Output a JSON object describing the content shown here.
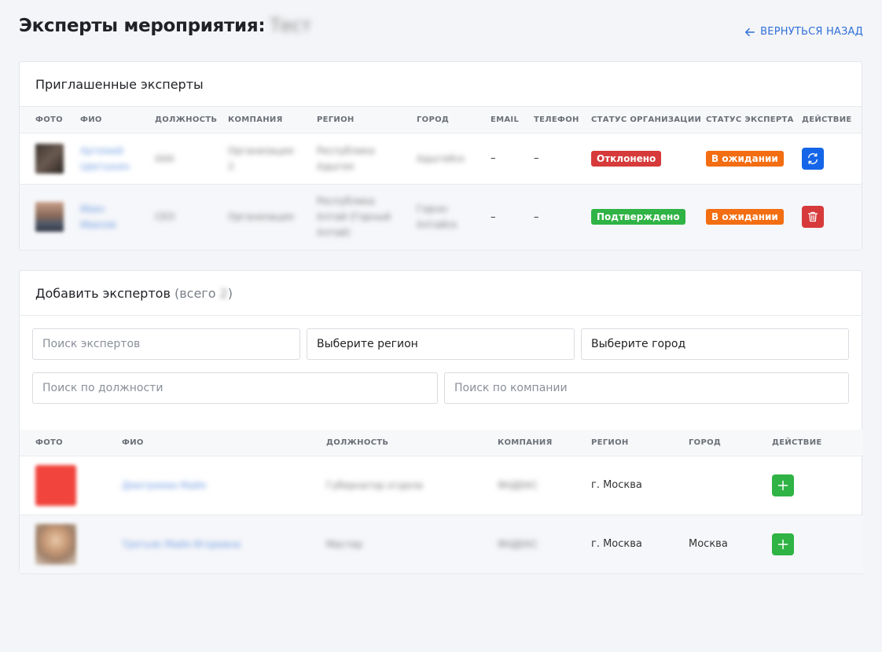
{
  "header": {
    "title": "Эксперты мероприятия:",
    "title_value": "Тест",
    "back_label": "ВЕРНУТЬСЯ НАЗАД"
  },
  "invited": {
    "title": "Приглашенные эксперты",
    "columns": [
      "ФОТО",
      "ФИО",
      "ДОЛЖНОСТЬ",
      "КОМПАНИЯ",
      "РЕГИОН",
      "ГОРОД",
      "EMAIL",
      "ТЕЛЕФОН",
      "СТАТУС ОРГАНИЗАЦИИ",
      "СТАТУС ЭКСПЕРТА",
      "ДЕЙСТВИЕ"
    ],
    "rows": [
      {
        "fio": "Артемий Цветыкин",
        "position": "ААА",
        "company": "Организация 2",
        "region": "Республика Адыгея",
        "city": "Адыгейск",
        "email": "–",
        "phone": "–",
        "org_status": "Отклонено",
        "expert_status": "В ожидании",
        "action_icon": "refresh-icon"
      },
      {
        "fio": "Иван Иванов",
        "position": "СЕО",
        "company": "Организация",
        "region": "Республика Алтай (Горный Алтай)",
        "city": "Горно-Алтайск",
        "email": "–",
        "phone": "–",
        "org_status": "Подтверждено",
        "expert_status": "В ожидании",
        "action_icon": "trash-icon"
      }
    ]
  },
  "add": {
    "title": "Добавить экспертов",
    "count_prefix": "(всего",
    "count_value": "2",
    "count_suffix": ")",
    "filters": {
      "search_placeholder": "Поиск экспертов",
      "region_select": "Выберите регион",
      "city_select": "Выберите город",
      "position_placeholder": "Поиск по должности",
      "company_placeholder": "Поиск по компании"
    },
    "columns": [
      "ФОТО",
      "ФИО",
      "ДОЛЖНОСТЬ",
      "КОМПАНИЯ",
      "РЕГИОН",
      "ГОРОД",
      "ДЕЙСТВИЕ"
    ],
    "rows": [
      {
        "fio": "Дмитриева Майя",
        "position": "Губернатор отдела",
        "company": "ЯНДЕКС",
        "region": "г. Москва",
        "city": "",
        "action_icon": "plus-icon"
      },
      {
        "fio": "Третьяк Майя Игоревна",
        "position": "Мастер",
        "company": "ЯНДЕКС",
        "region": "г. Москва",
        "city": "Москва",
        "action_icon": "plus-icon"
      }
    ]
  },
  "colors": {
    "accent": "#2f6fd8",
    "declined": "#d63a3a",
    "confirmed": "#2fb344",
    "pending": "#f36d12",
    "action_blue": "#1565e8"
  }
}
